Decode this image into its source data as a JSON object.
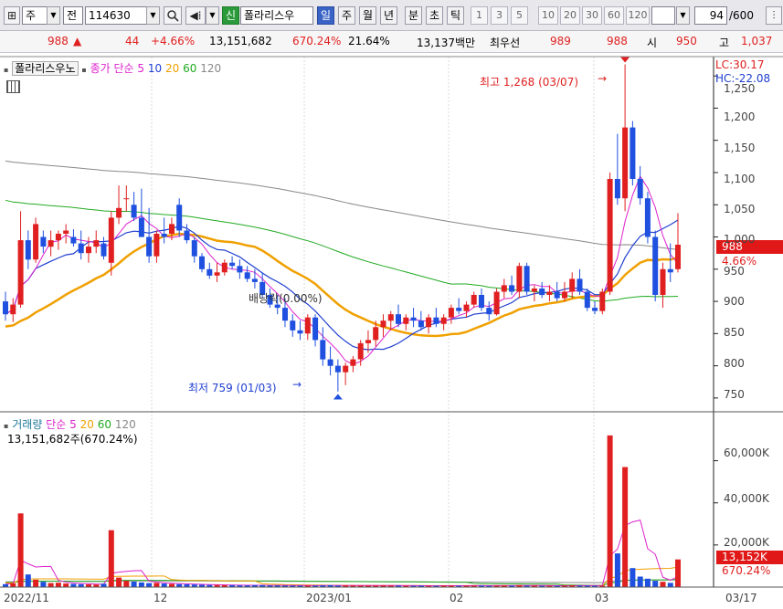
{
  "toolbar": {
    "market": "주",
    "type_label": "전",
    "code": "114630",
    "shin_label": "신",
    "stock_name": "폴라리스우",
    "periods": [
      "일",
      "주",
      "월",
      "년",
      "분",
      "초",
      "틱"
    ],
    "active_period": "일",
    "intervals": [
      "1",
      "3",
      "5",
      "10",
      "20",
      "30",
      "60",
      "120"
    ],
    "page_count": "94",
    "page_total": "/600"
  },
  "quote": {
    "price": "988",
    "change": "44",
    "change_pct": "+4.66%",
    "volume": "13,151,682",
    "volume_ratio": "670.24%",
    "turnover": "21.64%",
    "amount": "13,137백만",
    "best_label": "최우선",
    "ask": "989",
    "bid": "988",
    "open_label": "시",
    "open": "950",
    "high_label": "고",
    "high": "1,037"
  },
  "colors": {
    "up": "#e02020",
    "down": "#1f50e0",
    "ma5": "#dd22cc",
    "ma10": "#1f3fd0",
    "ma20": "#f0a000",
    "ma60": "#22aa22",
    "ma120": "#888888"
  },
  "price_chart": {
    "title": "폴라리스우노",
    "ma_label": "종가 단순",
    "ma_periods": [
      "5",
      "10",
      "20",
      "60",
      "120"
    ],
    "lc_label": "LC:30.17",
    "hc_label": "HC:-22.08",
    "y_ticks": [
      "1,250",
      "1,200",
      "1,150",
      "1,100",
      "1,050",
      "1,000",
      "950",
      "900",
      "850",
      "800",
      "750"
    ],
    "high_note": "최고 1,268 (03/07)",
    "low_note": "최저 759 (01/03)",
    "event_note": "배당락(0.00%)",
    "last_price": "988",
    "last_pct": "4.66%"
  },
  "volume_chart": {
    "title": "거래량",
    "ma_label": "단순",
    "ma_periods": [
      "5",
      "20",
      "60",
      "120"
    ],
    "summary": "13,151,682주(670.24%)",
    "y_ticks": [
      "60,000K",
      "40,000K",
      "20,000K"
    ],
    "last_volume": "13,152K",
    "last_pct": "670.24%"
  },
  "x_axis": {
    "labels": [
      "2022/11",
      "12",
      "2023/01",
      "02",
      "03",
      "03/17"
    ]
  },
  "chart_data": [
    {
      "type": "candlestick",
      "title": "폴라리스우노",
      "series_unit": "KRW",
      "ylim": [
        730,
        1280
      ],
      "candles": [
        [
          900,
          915,
          870,
          880
        ],
        [
          880,
          905,
          868,
          895
        ],
        [
          895,
          1040,
          890,
          995
        ],
        [
          995,
          1010,
          950,
          965
        ],
        [
          965,
          1030,
          960,
          1020
        ],
        [
          1000,
          1010,
          975,
          985
        ],
        [
          985,
          1010,
          970,
          995
        ],
        [
          995,
          1010,
          980,
          1005
        ],
        [
          1005,
          1020,
          990,
          1010
        ],
        [
          1000,
          1012,
          985,
          990
        ],
        [
          990,
          1010,
          965,
          975
        ],
        [
          975,
          1000,
          960,
          985
        ],
        [
          985,
          1010,
          975,
          995
        ],
        [
          990,
          1000,
          965,
          970
        ],
        [
          960,
          1040,
          940,
          1030
        ],
        [
          1030,
          1080,
          1020,
          1045
        ],
        [
          1060,
          1080,
          1040,
          1060
        ],
        [
          1050,
          1070,
          1025,
          1030
        ],
        [
          1030,
          1075,
          1000,
          1000
        ],
        [
          1000,
          1045,
          960,
          970
        ],
        [
          970,
          1010,
          960,
          1005
        ],
        [
          1005,
          1030,
          990,
          1000
        ],
        [
          1005,
          1030,
          995,
          1020
        ],
        [
          1050,
          1060,
          1000,
          1010
        ],
        [
          1010,
          1020,
          990,
          995
        ],
        [
          995,
          1000,
          960,
          970
        ],
        [
          970,
          975,
          945,
          950
        ],
        [
          950,
          960,
          935,
          940
        ],
        [
          940,
          960,
          930,
          945
        ],
        [
          945,
          965,
          940,
          960
        ],
        [
          960,
          970,
          950,
          955
        ],
        [
          955,
          965,
          935,
          945
        ],
        [
          945,
          955,
          930,
          935
        ],
        [
          935,
          950,
          920,
          930
        ],
        [
          930,
          945,
          905,
          910
        ],
        [
          910,
          920,
          890,
          895
        ],
        [
          895,
          910,
          880,
          890
        ],
        [
          890,
          905,
          860,
          870
        ],
        [
          870,
          880,
          845,
          855
        ],
        [
          855,
          870,
          840,
          850
        ],
        [
          850,
          880,
          840,
          875
        ],
        [
          875,
          880,
          830,
          840
        ],
        [
          840,
          860,
          800,
          810
        ],
        [
          810,
          830,
          785,
          800
        ],
        [
          800,
          810,
          760,
          790
        ],
        [
          790,
          805,
          770,
          800
        ],
        [
          800,
          815,
          790,
          810
        ],
        [
          810,
          840,
          800,
          835
        ],
        [
          835,
          855,
          820,
          840
        ],
        [
          840,
          870,
          830,
          860
        ],
        [
          860,
          880,
          845,
          870
        ],
        [
          870,
          885,
          855,
          880
        ],
        [
          880,
          895,
          860,
          865
        ],
        [
          865,
          880,
          855,
          875
        ],
        [
          875,
          890,
          860,
          870
        ],
        [
          870,
          885,
          855,
          860
        ],
        [
          860,
          880,
          850,
          875
        ],
        [
          875,
          890,
          860,
          865
        ],
        [
          865,
          880,
          855,
          875
        ],
        [
          875,
          895,
          865,
          890
        ],
        [
          890,
          905,
          880,
          885
        ],
        [
          885,
          900,
          875,
          895
        ],
        [
          895,
          915,
          890,
          910
        ],
        [
          910,
          920,
          885,
          890
        ],
        [
          890,
          900,
          870,
          880
        ],
        [
          880,
          920,
          878,
          915
        ],
        [
          915,
          935,
          905,
          925
        ],
        [
          925,
          940,
          910,
          915
        ],
        [
          915,
          960,
          905,
          955
        ],
        [
          955,
          960,
          910,
          915
        ],
        [
          915,
          925,
          900,
          920
        ],
        [
          920,
          930,
          905,
          910
        ],
        [
          910,
          925,
          900,
          915
        ],
        [
          915,
          930,
          900,
          905
        ],
        [
          905,
          930,
          900,
          915
        ],
        [
          915,
          945,
          905,
          935
        ],
        [
          935,
          950,
          910,
          915
        ],
        [
          915,
          920,
          885,
          890
        ],
        [
          890,
          900,
          880,
          885
        ],
        [
          885,
          920,
          880,
          915
        ],
        [
          915,
          1100,
          910,
          1090
        ],
        [
          1090,
          1160,
          1050,
          1060
        ],
        [
          1060,
          1268,
          1040,
          1170
        ],
        [
          1170,
          1180,
          1080,
          1090
        ],
        [
          1090,
          1110,
          1050,
          1060
        ],
        [
          1060,
          1070,
          990,
          1000
        ],
        [
          1000,
          1010,
          900,
          910
        ],
        [
          910,
          960,
          890,
          950
        ],
        [
          950,
          990,
          930,
          945
        ],
        [
          950,
          1037,
          945,
          988
        ]
      ]
    },
    {
      "type": "bar",
      "title": "거래량",
      "ylim": [
        0,
        75000
      ],
      "values": [
        1400,
        1800,
        35000,
        6000,
        3500,
        2500,
        1900,
        2100,
        1700,
        1500,
        1400,
        1300,
        1200,
        1600,
        27000,
        4500,
        3000,
        2600,
        2200,
        1900,
        2000,
        1700,
        1500,
        1400,
        1300,
        1200,
        1100,
        1000,
        1000,
        900,
        900,
        800,
        800,
        900,
        900,
        800,
        800,
        700,
        700,
        700,
        700,
        700,
        800,
        900,
        700,
        800,
        700,
        700,
        700,
        700,
        800,
        700,
        700,
        600,
        600,
        700,
        600,
        600,
        700,
        700,
        600,
        700,
        700,
        700,
        600,
        700,
        800,
        700,
        900,
        700,
        700,
        600,
        600,
        600,
        700,
        800,
        700,
        700,
        600,
        700,
        72000,
        16000,
        57000,
        9000,
        5000,
        4000,
        3000,
        2500,
        2000,
        13152
      ]
    }
  ]
}
